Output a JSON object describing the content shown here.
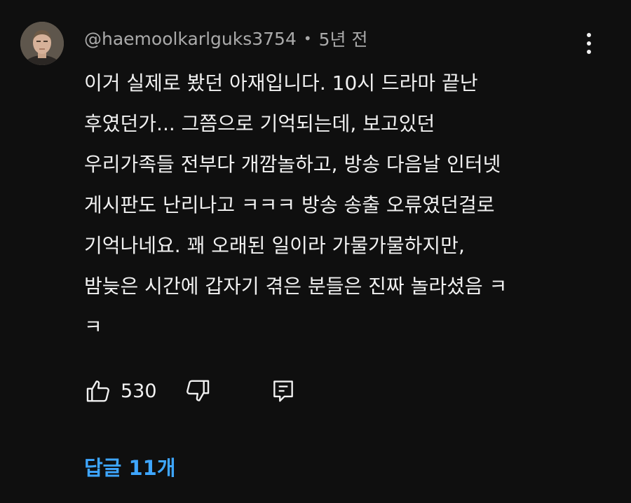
{
  "comment": {
    "author": "@haemoolkarlguks3754",
    "separator": "•",
    "time_ago": "5년 전",
    "text_lines": [
      "이거 실제로 봤던 아재입니다.  10시 드라마 끝난",
      "후였던가... 그쯤으로 기억되는데, 보고있던",
      "우리가족들 전부다 개깜놀하고, 방송 다음날 인터넷",
      "게시판도 난리나고 ㅋㅋㅋ 방송 송출 오류였던걸로",
      "기억나네요. 꽤 오래된 일이라 가물가물하지만,",
      "밤늦은 시간에 갑자기 겪은 분들은 진짜 놀라셨음 ㅋ",
      "ㅋ"
    ],
    "like_count": "530",
    "replies_label": "답글 11개"
  },
  "icons": {
    "avatar": "user-avatar",
    "more": "more-vertical-icon",
    "like": "thumbs-up-icon",
    "dislike": "thumbs-down-icon",
    "reply": "reply-comment-icon"
  },
  "colors": {
    "background": "#0f0f0f",
    "text": "#f1f1f1",
    "muted": "#aaaaaa",
    "link": "#3ea6ff"
  }
}
